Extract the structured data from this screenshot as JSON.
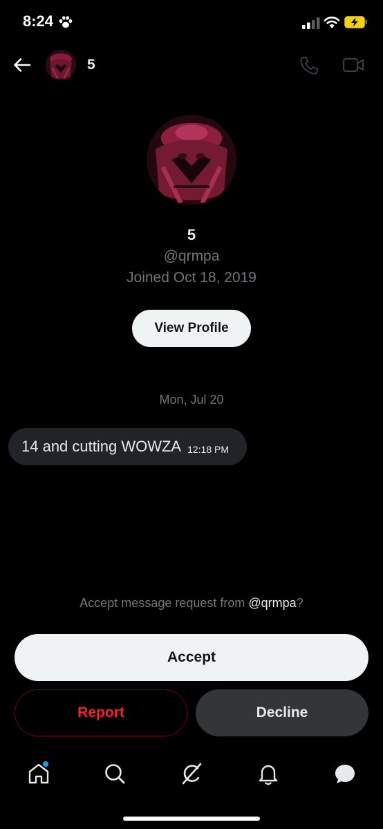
{
  "status_bar": {
    "time": "8:24"
  },
  "header": {
    "name": "5"
  },
  "profile": {
    "name": "5",
    "handle": "@qrmpa",
    "joined": "Joined Oct 18, 2019",
    "view_profile_label": "View Profile"
  },
  "conversation": {
    "date_separator": "Mon, Jul 20",
    "messages": [
      {
        "text": "14 and cutting WOWZA",
        "time": "12:18 PM"
      }
    ]
  },
  "request": {
    "prompt_prefix": "Accept message request from ",
    "prompt_handle": "@qrmpa",
    "prompt_suffix": "?",
    "accept_label": "Accept",
    "report_label": "Report",
    "decline_label": "Decline"
  },
  "tab_bar": {
    "items": [
      "home-icon",
      "search-icon",
      "grok-icon",
      "notifications-bell-icon",
      "messages-icon"
    ]
  },
  "colors": {
    "background": "#000000",
    "bubble": "#202327",
    "secondary_text": "#71767b",
    "report_red": "#f4212e",
    "notification_dot": "#1d9bf0"
  }
}
